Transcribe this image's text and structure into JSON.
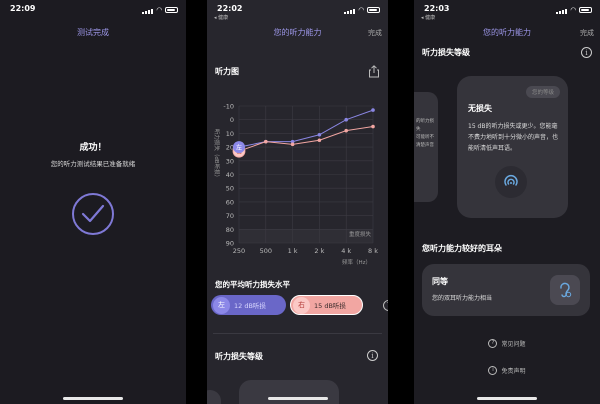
{
  "phone1": {
    "time": "22:09",
    "nav_title": "测试完成",
    "success_title": "成功！",
    "success_sub": "您的听力测试结果已准备就绪"
  },
  "phone2": {
    "time": "22:02",
    "back": "◂ 健康",
    "nav_title": "您的听力能力",
    "done": "完成",
    "audiogram_title": "听力图",
    "chart_data": {
      "type": "line",
      "title": "",
      "ylabel": "听力损失（dB听损）",
      "xlabel": "频率（Hz）",
      "x_ticks": [
        "250",
        "500",
        "1 k",
        "2 k",
        "4 k",
        "8 k"
      ],
      "y_ticks": [
        "-10",
        "0",
        "10",
        "20",
        "30",
        "40",
        "50",
        "60",
        "70",
        "80",
        "90"
      ],
      "ylim": [
        -10,
        90
      ],
      "y_inverted": true,
      "zone_label": "重度损失",
      "series": [
        {
          "name": "左",
          "color": "#8a86e3",
          "values": [
            20,
            16,
            16,
            11,
            0,
            -7
          ]
        },
        {
          "name": "右",
          "color": "#f2a6a2",
          "values": [
            23,
            16,
            18,
            15,
            8,
            5
          ]
        }
      ],
      "start_markers": {
        "left": "左",
        "right": "右"
      }
    },
    "avg_title": "您的平均听力损失水平",
    "left_label": "左",
    "left_value": "12 dB听损",
    "right_label": "右",
    "right_value": "15 dB听损",
    "help": "?",
    "loss_level_title": "听力损失等级",
    "info": "i"
  },
  "phone3": {
    "time": "22:03",
    "back": "◂ 健康",
    "nav_title": "您的听力能力",
    "done": "完成",
    "loss_level_title": "听力损失等级",
    "info": "i",
    "side_card_text": [
      "的听力损失",
      "可能听不",
      "清楚声音"
    ],
    "card_badge": "您的等级",
    "card_title": "无损失",
    "card_desc": "15 dB的听力损失或更少。您能毫不费力地听到十分微小的声音，也能听清低声耳语。",
    "better_ear_title": "您听力能力较好的耳朵",
    "ear_card_title": "同等",
    "ear_card_desc": "您的双耳听力能力相当",
    "faq": "常见问题",
    "disclaimer": "免责声明"
  },
  "colors": {
    "accent_purple": "#8a86e3",
    "accent_pink": "#f2a6a2"
  }
}
